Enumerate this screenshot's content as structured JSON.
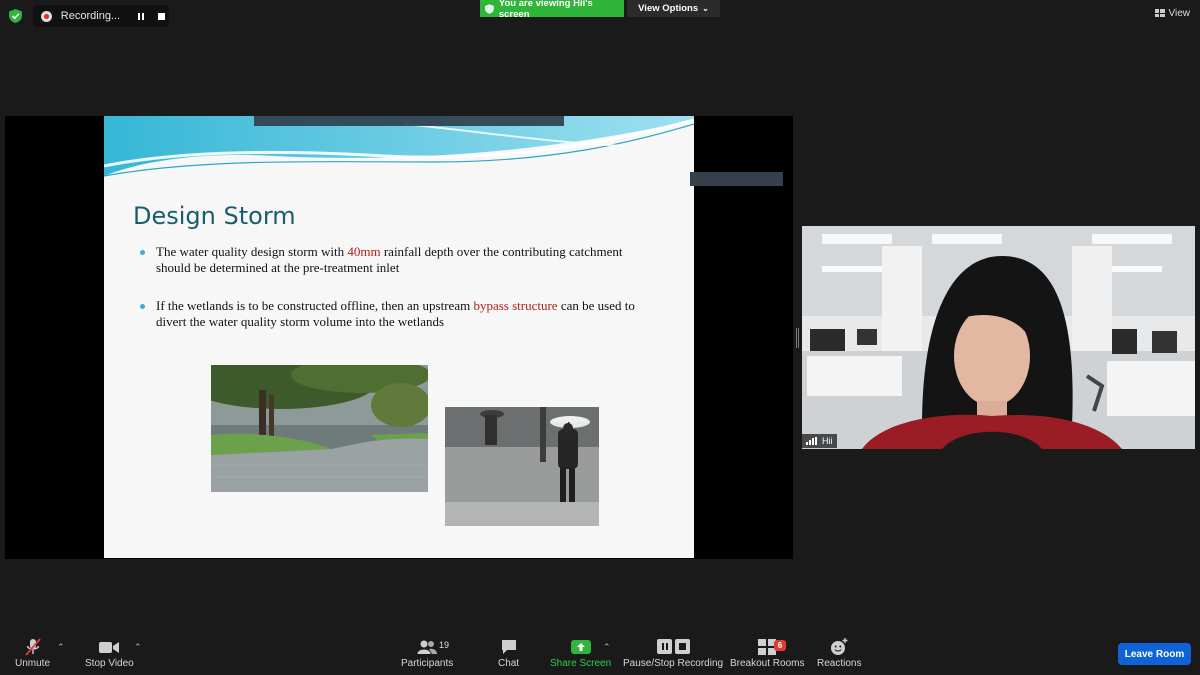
{
  "top": {
    "recording_label": "Recording...",
    "viewing_banner": "You are viewing Hii's screen",
    "view_options": "View Options",
    "view_button": "View"
  },
  "slide": {
    "title": "Design Storm",
    "bullet1": {
      "pre": "The water quality design storm with ",
      "highlight": "40mm",
      "post": " rainfall depth over the contributing catchment should be determined at the pre-treatment inlet"
    },
    "bullet2": {
      "pre": "If the wetlands is to be constructed offline, then an upstream ",
      "highlight": "bypass structure",
      "post": " can be used to divert the water quality storm volume into the wetlands"
    },
    "highlight_color": "#b21e1e",
    "title_color": "#1a5d6e"
  },
  "participant": {
    "name": "Hii"
  },
  "toolbar": {
    "unmute": "Unmute",
    "stop_video": "Stop Video",
    "participants": "Participants",
    "participants_count": "19",
    "chat": "Chat",
    "share_screen": "Share Screen",
    "recording": "Pause/Stop Recording",
    "breakout_rooms": "Breakout Rooms",
    "breakout_badge": "6",
    "reactions": "Reactions",
    "leave_room": "Leave Room"
  },
  "colors": {
    "green_banner": "#2fb53a",
    "share_green": "#2fb53a",
    "leave_blue": "#0e63d6",
    "background": "#1a1a1a"
  }
}
